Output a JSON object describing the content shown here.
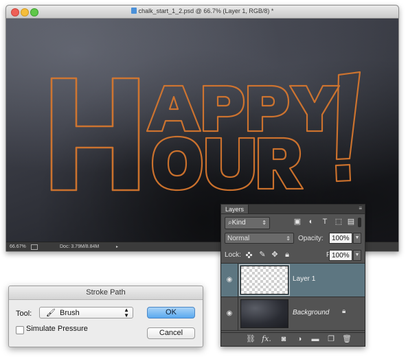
{
  "document": {
    "title": "chalk_start_1_2.psd @ 66.7% (Layer 1, RGB/8) *",
    "zoom": "66.67%",
    "doc_size": "Doc: 3.79M/8.84M",
    "status_arrow": "▸",
    "artwork_letters": [
      "H",
      "APPY",
      "OUR",
      "!"
    ],
    "stroke_color": "#d9782e"
  },
  "layers_panel": {
    "tab": "Layers",
    "menu_icon": "≡",
    "kind_label": "Kind",
    "kind_icon": "⌕",
    "blend_mode": "Normal",
    "opacity_label": "Opacity:",
    "opacity": "100%",
    "lock_label": "Lock:",
    "fill_label": "Fill:",
    "fill": "100%",
    "layers": [
      {
        "name": "Layer 1",
        "selected": true,
        "visible": true
      },
      {
        "name": "Background",
        "selected": false,
        "visible": true,
        "locked": true
      }
    ],
    "filter_icons": [
      "image-filter-icon",
      "adjustment-filter-icon",
      "type-filter-icon",
      "shape-filter-icon",
      "smartobject-filter-icon"
    ],
    "bottom_icons": [
      "link-icon",
      "fx-icon",
      "mask-icon",
      "adjustment-icon",
      "folder-icon",
      "new-layer-icon",
      "trash-icon"
    ],
    "fx_text": "fx."
  },
  "stroke_dialog": {
    "title": "Stroke Path",
    "tool_label": "Tool:",
    "tool_value": "Brush",
    "simulate_pressure": "Simulate Pressure",
    "simulate_checked": false,
    "ok_label": "OK",
    "cancel_label": "Cancel"
  }
}
